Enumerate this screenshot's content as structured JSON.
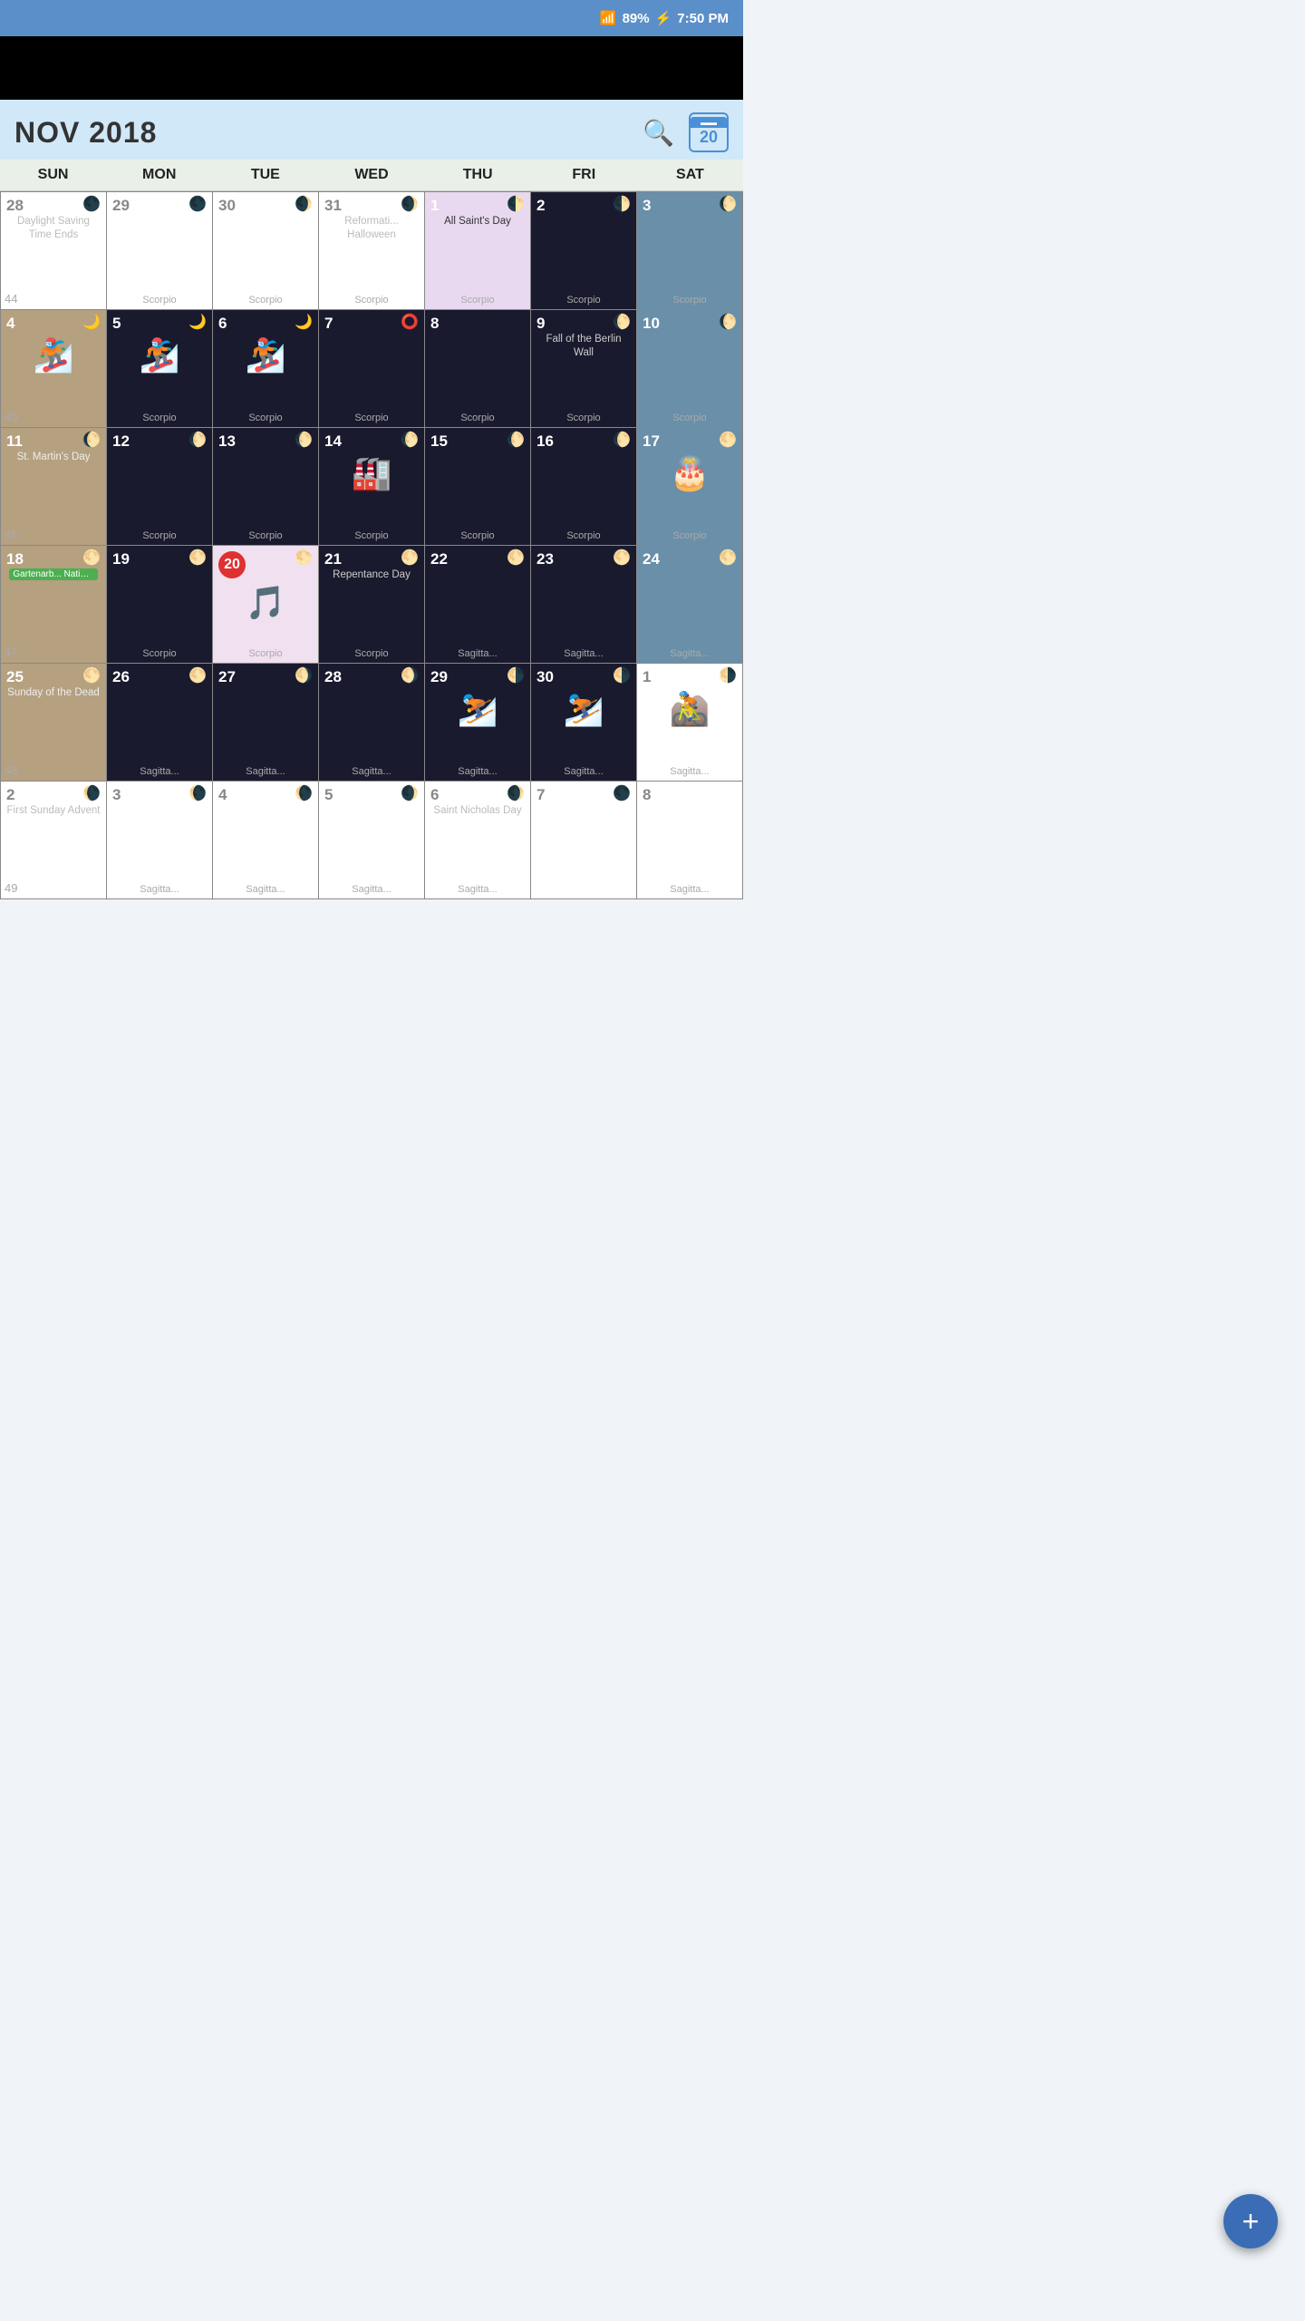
{
  "statusBar": {
    "signal": "▋▋▋▋",
    "battery": "89%",
    "time": "7:50 PM"
  },
  "header": {
    "title": "NOV 2018",
    "searchLabel": "Search",
    "calDay": "20"
  },
  "dayHeaders": [
    "SUN",
    "MON",
    "TUE",
    "WED",
    "THU",
    "FRI",
    "SAT"
  ],
  "weeks": [
    {
      "cells": [
        {
          "date": "28",
          "greyDate": true,
          "moon": "🌑",
          "moonColor": "grey",
          "bg": "white",
          "event": "Daylight Saving Time Ends",
          "week": "44",
          "zodiac": ""
        },
        {
          "date": "29",
          "greyDate": true,
          "moon": "🌑",
          "moonColor": "grey",
          "bg": "white",
          "event": "",
          "week": "",
          "zodiac": "Scorpio"
        },
        {
          "date": "30",
          "greyDate": true,
          "moon": "🌒",
          "moonColor": "grey",
          "bg": "white",
          "event": "",
          "week": "",
          "zodiac": "Scorpio"
        },
        {
          "date": "31",
          "greyDate": true,
          "moon": "🌒",
          "moonColor": "grey",
          "bg": "white",
          "event": "Reformati... Halloween",
          "week": "",
          "zodiac": "Scorpio"
        },
        {
          "date": "1",
          "greyDate": false,
          "moon": "🌓",
          "moonColor": "yellow",
          "bg": "lavender",
          "event": "All Saint's Day",
          "week": "",
          "zodiac": "Scorpio"
        },
        {
          "date": "2",
          "greyDate": false,
          "moon": "🌓",
          "moonColor": "yellow",
          "bg": "dark",
          "event": "",
          "week": "",
          "zodiac": "Scorpio"
        },
        {
          "date": "3",
          "greyDate": false,
          "moon": "🌔",
          "moonColor": "yellow",
          "bg": "bluegrey",
          "event": "",
          "week": "",
          "zodiac": "Scorpio"
        }
      ]
    },
    {
      "cells": [
        {
          "date": "4",
          "greyDate": false,
          "moon": "🌙",
          "moonColor": "yellow",
          "bg": "tan",
          "event": "",
          "emoji": "🏂",
          "week": "45",
          "zodiac": ""
        },
        {
          "date": "5",
          "greyDate": false,
          "moon": "🌙",
          "moonColor": "yellow",
          "bg": "dark",
          "event": "",
          "emoji": "🏂",
          "week": "",
          "zodiac": "Scorpio"
        },
        {
          "date": "6",
          "greyDate": false,
          "moon": "🌙",
          "moonColor": "yellow",
          "bg": "dark",
          "event": "",
          "emoji": "🏂",
          "week": "",
          "zodiac": "Scorpio"
        },
        {
          "date": "7",
          "greyDate": false,
          "moon": "⭕",
          "moonColor": "yellow",
          "bg": "dark",
          "event": "",
          "week": "",
          "zodiac": "Scorpio"
        },
        {
          "date": "8",
          "greyDate": false,
          "moon": "",
          "moonColor": "",
          "bg": "dark",
          "event": "",
          "week": "",
          "zodiac": "Scorpio"
        },
        {
          "date": "9",
          "greyDate": false,
          "moon": "🌔",
          "moonColor": "yellow",
          "bg": "dark",
          "event": "Fall of the Berlin Wall",
          "week": "",
          "zodiac": "Scorpio"
        },
        {
          "date": "10",
          "greyDate": false,
          "moon": "🌔",
          "moonColor": "yellow",
          "bg": "bluegrey",
          "event": "",
          "week": "",
          "zodiac": "Scorpio"
        }
      ]
    },
    {
      "cells": [
        {
          "date": "11",
          "greyDate": false,
          "moon": "🌔",
          "moonColor": "yellow",
          "bg": "tan",
          "event": "St. Martin's Day",
          "week": "46",
          "zodiac": ""
        },
        {
          "date": "12",
          "greyDate": false,
          "moon": "🌔",
          "moonColor": "yellow",
          "bg": "dark",
          "event": "",
          "week": "",
          "zodiac": "Scorpio"
        },
        {
          "date": "13",
          "greyDate": false,
          "moon": "🌔",
          "moonColor": "yellow",
          "bg": "dark",
          "event": "",
          "week": "",
          "zodiac": "Scorpio"
        },
        {
          "date": "14",
          "greyDate": false,
          "moon": "🌔",
          "moonColor": "yellow",
          "bg": "dark",
          "event": "",
          "emoji": "🏭",
          "week": "",
          "zodiac": "Scorpio"
        },
        {
          "date": "15",
          "greyDate": false,
          "moon": "🌔",
          "moonColor": "yellow",
          "bg": "dark",
          "event": "",
          "week": "",
          "zodiac": "Scorpio"
        },
        {
          "date": "16",
          "greyDate": false,
          "moon": "🌔",
          "moonColor": "yellow",
          "bg": "dark",
          "event": "",
          "week": "",
          "zodiac": "Scorpio"
        },
        {
          "date": "17",
          "greyDate": false,
          "moon": "🌕",
          "moonColor": "yellow",
          "bg": "bluegrey",
          "event": "",
          "emoji": "🎂",
          "week": "",
          "zodiac": "Scorpio"
        }
      ]
    },
    {
      "cells": [
        {
          "date": "18",
          "greyDate": false,
          "moon": "🌕",
          "moonColor": "yellow",
          "bg": "tan",
          "event": "",
          "badge": "Gartenarb... National...",
          "week": "47",
          "zodiac": ""
        },
        {
          "date": "19",
          "greyDate": false,
          "moon": "🌕",
          "moonColor": "yellow",
          "bg": "dark",
          "event": "",
          "week": "",
          "zodiac": "Scorpio"
        },
        {
          "date": "20",
          "greyDate": false,
          "moon": "🌕",
          "moonColor": "yellow",
          "bg": "pink",
          "event": "",
          "emoji": "🎵",
          "today": true,
          "week": "",
          "zodiac": "Scorpio"
        },
        {
          "date": "21",
          "greyDate": false,
          "moon": "🌕",
          "moonColor": "yellow",
          "bg": "dark",
          "event": "Repentance Day",
          "week": "",
          "zodiac": "Scorpio"
        },
        {
          "date": "22",
          "greyDate": false,
          "moon": "🌕",
          "moonColor": "yellow",
          "bg": "dark",
          "event": "",
          "week": "",
          "zodiac": "Sagitta..."
        },
        {
          "date": "23",
          "greyDate": false,
          "moon": "🌕",
          "moonColor": "yellow",
          "bg": "dark",
          "event": "",
          "week": "",
          "zodiac": "Sagitta..."
        },
        {
          "date": "24",
          "greyDate": false,
          "moon": "🌕",
          "moonColor": "yellow",
          "bg": "bluegrey",
          "event": "",
          "week": "",
          "zodiac": "Sagitta..."
        }
      ]
    },
    {
      "cells": [
        {
          "date": "25",
          "greyDate": false,
          "moon": "🌕",
          "moonColor": "yellow",
          "bg": "tan",
          "event": "Sunday of the Dead",
          "week": "48",
          "zodiac": ""
        },
        {
          "date": "26",
          "greyDate": false,
          "moon": "🌕",
          "moonColor": "yellow",
          "bg": "dark",
          "event": "",
          "week": "",
          "zodiac": "Sagitta..."
        },
        {
          "date": "27",
          "greyDate": false,
          "moon": "🌖",
          "moonColor": "yellow",
          "bg": "dark",
          "event": "",
          "week": "",
          "zodiac": "Sagitta..."
        },
        {
          "date": "28",
          "greyDate": false,
          "moon": "🌖",
          "moonColor": "yellow",
          "bg": "dark",
          "event": "",
          "week": "",
          "zodiac": "Sagitta..."
        },
        {
          "date": "29",
          "greyDate": false,
          "moon": "🌗",
          "moonColor": "yellow",
          "bg": "dark",
          "event": "",
          "emoji": "⛷️",
          "week": "",
          "zodiac": "Sagitta..."
        },
        {
          "date": "30",
          "greyDate": false,
          "moon": "🌗",
          "moonColor": "yellow",
          "bg": "dark",
          "event": "",
          "emoji": "⛷️",
          "week": "",
          "zodiac": "Sagitta..."
        },
        {
          "date": "1",
          "greyDate": true,
          "moon": "🌗",
          "moonColor": "grey",
          "bg": "white",
          "event": "",
          "emoji": "🚵",
          "week": "",
          "zodiac": "Sagitta..."
        }
      ]
    },
    {
      "cells": [
        {
          "date": "2",
          "greyDate": true,
          "moon": "🌘",
          "moonColor": "grey",
          "bg": "white",
          "event": "First Sunday Advent",
          "week": "49",
          "zodiac": ""
        },
        {
          "date": "3",
          "greyDate": true,
          "moon": "🌘",
          "moonColor": "grey",
          "bg": "white",
          "event": "",
          "week": "",
          "zodiac": "Sagitta..."
        },
        {
          "date": "4",
          "greyDate": true,
          "moon": "🌘",
          "moonColor": "grey",
          "bg": "white",
          "event": "",
          "week": "",
          "zodiac": "Sagitta..."
        },
        {
          "date": "5",
          "greyDate": true,
          "moon": "🌒",
          "moonColor": "grey",
          "bg": "white",
          "event": "",
          "week": "",
          "zodiac": "Sagitta..."
        },
        {
          "date": "6",
          "greyDate": true,
          "moon": "🌒",
          "moonColor": "grey",
          "bg": "white",
          "event": "Saint Nicholas Day",
          "week": "",
          "zodiac": "Sagitta..."
        },
        {
          "date": "7",
          "greyDate": true,
          "moon": "🌑",
          "moonColor": "grey",
          "bg": "white",
          "event": "",
          "week": "",
          "zodiac": ""
        },
        {
          "date": "8",
          "greyDate": true,
          "moon": "",
          "moonColor": "grey",
          "bg": "white",
          "event": "",
          "week": "",
          "zodiac": "Sagitta..."
        }
      ]
    }
  ],
  "fab": {
    "label": "+"
  }
}
